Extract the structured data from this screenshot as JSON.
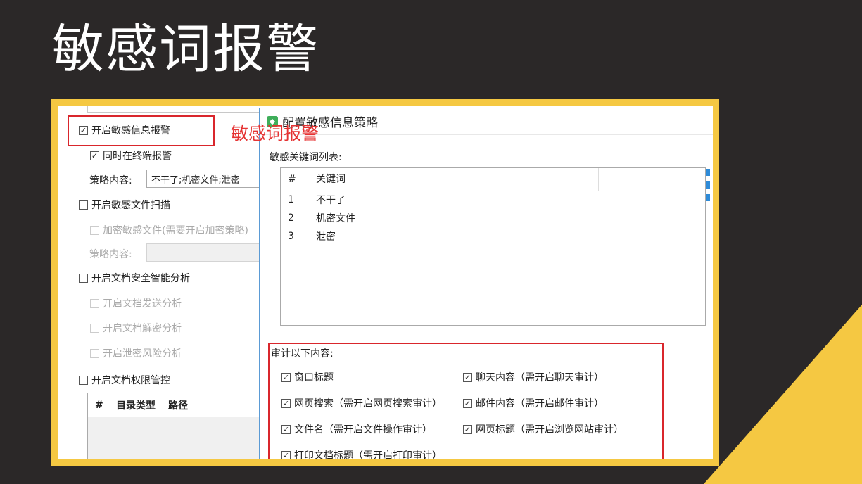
{
  "slide": {
    "title": "敏感词报警",
    "accent_color": "#f5c842",
    "highlight_color": "#d9262c"
  },
  "annotation": {
    "label": "敏感词报警"
  },
  "left_panel": {
    "enable_alert": {
      "label": "开启敏感信息报警",
      "checked": true
    },
    "terminal_alert": {
      "label": "同时在终端报警",
      "checked": true
    },
    "policy_content_label": "策略内容:",
    "policy_content_value": "不干了;机密文件;泄密",
    "enable_file_scan": {
      "label": "开启敏感文件扫描",
      "checked": false
    },
    "encrypt_sensitive": {
      "label": "加密敏感文件(需要开启加密策略)",
      "checked": false
    },
    "policy_content_label_2": "策略内容:",
    "enable_doc_analysis": {
      "label": "开启文档安全智能分析",
      "checked": false
    },
    "doc_send_analysis": {
      "label": "开启文档发送分析",
      "checked": false
    },
    "doc_decrypt_analysis": {
      "label": "开启文档解密分析",
      "checked": false
    },
    "leak_risk_analysis": {
      "label": "开启泄密风险分析",
      "checked": false
    },
    "enable_permission": {
      "label": "开启文档权限管控",
      "checked": false
    },
    "table_headers": [
      "#",
      "目录类型",
      "路径"
    ]
  },
  "dialog": {
    "title": "配置敏感信息策略",
    "keyword_list_label": "敏感关键词列表:",
    "keyword_headers": [
      "#",
      "关键词"
    ],
    "keywords": [
      {
        "num": "1",
        "word": "不干了"
      },
      {
        "num": "2",
        "word": "机密文件"
      },
      {
        "num": "3",
        "word": "泄密"
      }
    ],
    "audit_label": "审计以下内容:",
    "audit_options": [
      {
        "label": "窗口标题",
        "checked": true
      },
      {
        "label": "聊天内容（需开启聊天审计）",
        "checked": true
      },
      {
        "label": "网页搜索（需开启网页搜索审计）",
        "checked": true
      },
      {
        "label": "邮件内容（需开启邮件审计）",
        "checked": true
      },
      {
        "label": "文件名（需开启文件操作审计）",
        "checked": true
      },
      {
        "label": "网页标题（需开启浏览网站审计）",
        "checked": true
      },
      {
        "label": "打印文档标题（需开启打印审计）",
        "checked": true
      }
    ]
  }
}
